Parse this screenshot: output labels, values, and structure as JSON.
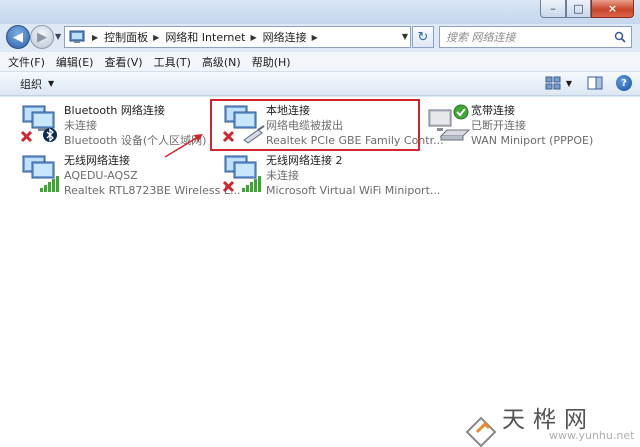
{
  "window": {
    "min_label": "–",
    "max_label": "□",
    "close_label": "×"
  },
  "address": {
    "crumbs": [
      "控制面板",
      "网络和 Internet",
      "网络连接"
    ]
  },
  "search": {
    "placeholder": "搜索 网络连接"
  },
  "menubar": {
    "items": [
      "文件(F)",
      "编辑(E)",
      "查看(V)",
      "工具(T)",
      "高级(N)",
      "帮助(H)"
    ]
  },
  "toolbar": {
    "organize_label": "组织",
    "help_label": "?"
  },
  "connections": [
    {
      "name": "Bluetooth 网络连接",
      "status": "未连接",
      "device": "Bluetooth 设备(个人区域网)",
      "icon": "bluetooth-connection-icon",
      "state": "disconnected"
    },
    {
      "name": "本地连接",
      "status": "网络电缆被拔出",
      "device": "Realtek PCIe GBE Family Contr...",
      "icon": "ethernet-connection-icon",
      "state": "unplugged"
    },
    {
      "name": "宽带连接",
      "status": "已断开连接",
      "device": "WAN Miniport (PPPOE)",
      "icon": "broadband-connection-icon",
      "state": "disconnected-ok"
    },
    {
      "name": "无线网络连接",
      "status": "AQEDU-AQSZ",
      "device": "Realtek RTL8723BE Wireless L...",
      "icon": "wireless-connection-icon",
      "state": "connected"
    },
    {
      "name": "无线网络连接 2",
      "status": "未连接",
      "device": "Microsoft Virtual WiFi Miniport...",
      "icon": "wireless-connection-icon",
      "state": "disconnected"
    }
  ],
  "watermark": {
    "text": "天桦网",
    "url": "www.yunhu.net"
  },
  "colors": {
    "highlight": "#d2252d",
    "error": "#d2252d",
    "signal": "#3fa535"
  }
}
